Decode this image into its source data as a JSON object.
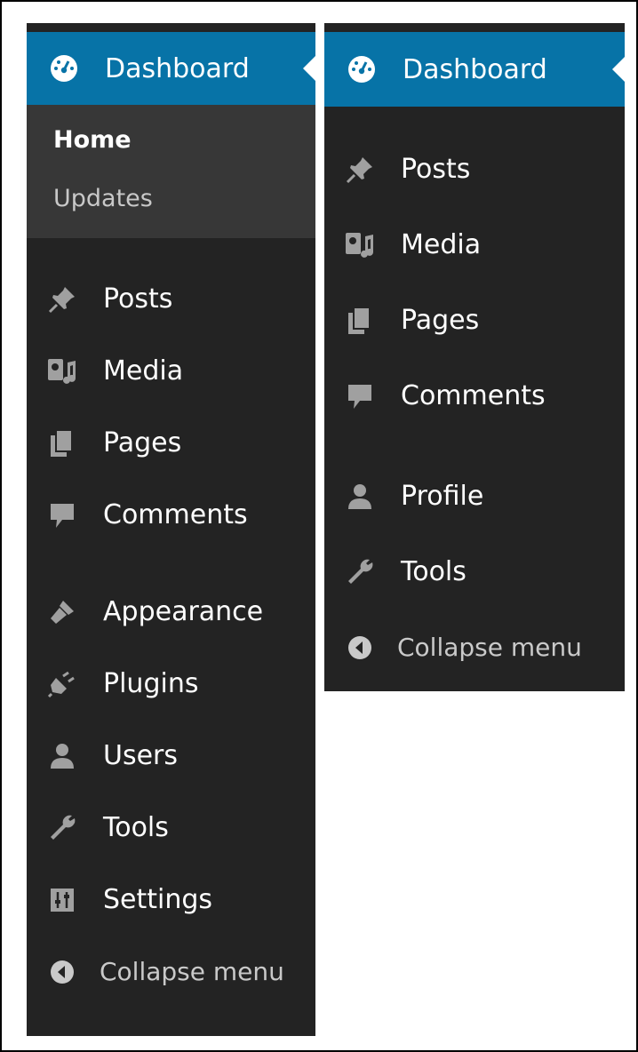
{
  "expanded_menu": {
    "dashboard": {
      "label": "Dashboard",
      "icon": "dashboard-icon"
    },
    "submenu": [
      {
        "label": "Home",
        "current": true
      },
      {
        "label": "Updates",
        "current": false
      }
    ],
    "items": [
      {
        "label": "Posts",
        "icon": "pushpin-icon"
      },
      {
        "label": "Media",
        "icon": "media-icon"
      },
      {
        "label": "Pages",
        "icon": "pages-icon"
      },
      {
        "label": "Comments",
        "icon": "comment-icon"
      },
      {
        "label": "Appearance",
        "icon": "paintbrush-icon"
      },
      {
        "label": "Plugins",
        "icon": "plugin-icon"
      },
      {
        "label": "Users",
        "icon": "user-icon"
      },
      {
        "label": "Tools",
        "icon": "wrench-icon"
      },
      {
        "label": "Settings",
        "icon": "settings-icon"
      }
    ],
    "collapse": {
      "label": "Collapse menu",
      "icon": "collapse-arrow-icon"
    }
  },
  "collapsed_menu": {
    "dashboard": {
      "label": "Dashboard",
      "icon": "dashboard-icon"
    },
    "items": [
      {
        "label": "Posts",
        "icon": "pushpin-icon"
      },
      {
        "label": "Media",
        "icon": "media-icon"
      },
      {
        "label": "Pages",
        "icon": "pages-icon"
      },
      {
        "label": "Comments",
        "icon": "comment-icon"
      },
      {
        "label": "Profile",
        "icon": "user-icon"
      },
      {
        "label": "Tools",
        "icon": "wrench-icon"
      }
    ],
    "collapse": {
      "label": "Collapse menu",
      "icon": "collapse-arrow-icon"
    }
  },
  "colors": {
    "menu_bg": "#232323",
    "submenu_bg": "#373737",
    "active_bg": "#0773a7",
    "text": "#ffffff",
    "muted_text": "#c8c8c8"
  }
}
